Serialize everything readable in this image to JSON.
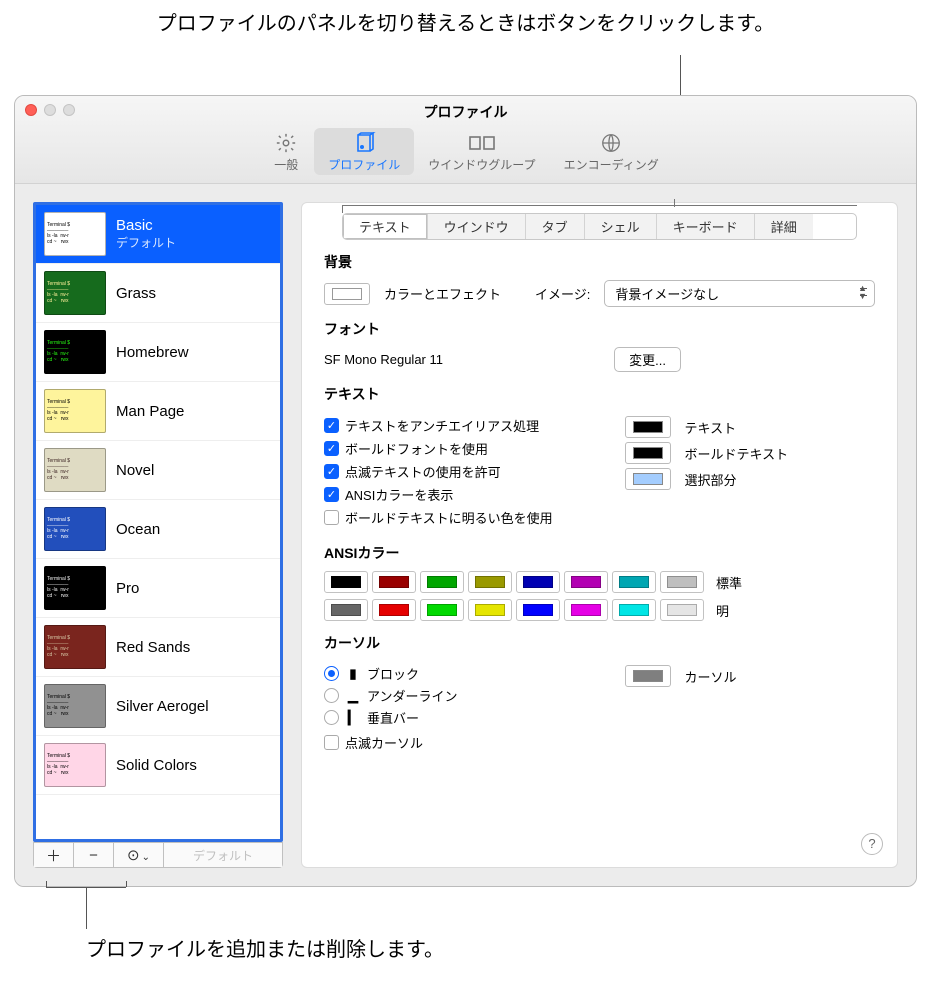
{
  "callouts": {
    "top": "プロファイルのパネルを切り替えるときはボタンをクリックします。",
    "bottom": "プロファイルを追加または削除します。"
  },
  "window": {
    "title": "プロファイル"
  },
  "toolbar": {
    "general": "一般",
    "profile": "プロファイル",
    "window_group": "ウインドウグループ",
    "encoding": "エンコーディング"
  },
  "profiles": [
    {
      "name": "Basic",
      "subtitle": "デフォルト",
      "bg": "#ffffff",
      "fg": "#000000",
      "selected": true
    },
    {
      "name": "Grass",
      "subtitle": "",
      "bg": "#166b1d",
      "fg": "#fff09a"
    },
    {
      "name": "Homebrew",
      "subtitle": "",
      "bg": "#000000",
      "fg": "#28fe14"
    },
    {
      "name": "Man Page",
      "subtitle": "",
      "bg": "#fef49c",
      "fg": "#000000"
    },
    {
      "name": "Novel",
      "subtitle": "",
      "bg": "#dfdbc3",
      "fg": "#3b2322"
    },
    {
      "name": "Ocean",
      "subtitle": "",
      "bg": "#224fbc",
      "fg": "#ffffff"
    },
    {
      "name": "Pro",
      "subtitle": "",
      "bg": "#000000",
      "fg": "#f2f2f2"
    },
    {
      "name": "Red Sands",
      "subtitle": "",
      "bg": "#7a251e",
      "fg": "#d7c9a7"
    },
    {
      "name": "Silver Aerogel",
      "subtitle": "",
      "bg": "#919191",
      "fg": "#000000"
    },
    {
      "name": "Solid Colors",
      "subtitle": "",
      "bg": "#ffd6e7",
      "fg": "#000000"
    }
  ],
  "list_buttons": {
    "add": "＋",
    "remove": "−",
    "more": "⊙",
    "more_caret": "⌄",
    "default": "デフォルト"
  },
  "tabs": {
    "text": "テキスト",
    "window": "ウインドウ",
    "tab": "タブ",
    "shell": "シェル",
    "keyboard": "キーボード",
    "advanced": "詳細"
  },
  "bg_section": {
    "title": "背景",
    "color_effects": "カラーとエフェクト",
    "image_label": "イメージ:",
    "image_value": "背景イメージなし"
  },
  "font_section": {
    "title": "フォント",
    "value": "SF Mono Regular 11",
    "change": "変更..."
  },
  "text_section": {
    "title": "テキスト",
    "antialias": "テキストをアンチエイリアス処理",
    "bold_font": "ボールドフォントを使用",
    "blink_text": "点滅テキストの使用を許可",
    "ansi_colors": "ANSIカラーを表示",
    "bright_bold": "ボールドテキストに明るい色を使用",
    "label_text": "テキスト",
    "label_bold": "ボールドテキスト",
    "label_sel": "選択部分",
    "color_text": "#000000",
    "color_bold": "#000000",
    "color_sel": "#a4cdfe"
  },
  "ansi_section": {
    "title": "ANSIカラー",
    "normal": "標準",
    "bright": "明",
    "normal_colors": [
      "#000000",
      "#990000",
      "#00a600",
      "#999900",
      "#0000b2",
      "#b200b2",
      "#00a6b2",
      "#bfbfbf"
    ],
    "bright_colors": [
      "#666666",
      "#e50000",
      "#00d900",
      "#e5e500",
      "#0000ff",
      "#e500e5",
      "#00e5e5",
      "#e5e5e5"
    ]
  },
  "cursor_section": {
    "title": "カーソル",
    "block": "ブロック",
    "underline": "アンダーライン",
    "bar": "垂直バー",
    "blink": "点滅カーソル",
    "label": "カーソル",
    "color": "#7f7f7f"
  },
  "help": "?"
}
